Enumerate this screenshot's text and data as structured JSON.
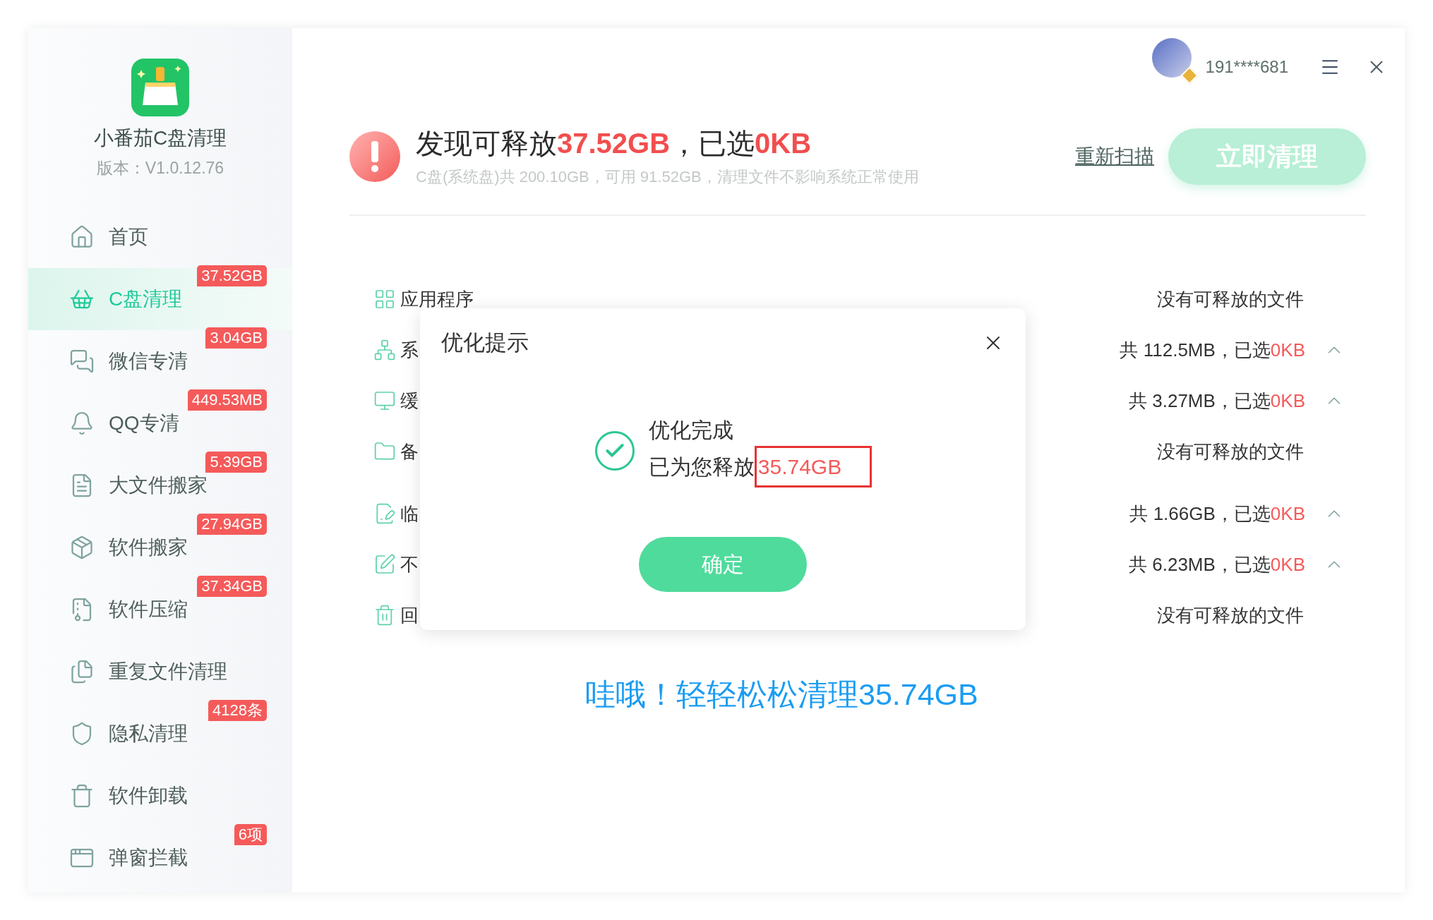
{
  "app": {
    "name": "小番茄C盘清理",
    "version": "版本：V1.0.12.76"
  },
  "nav": [
    {
      "label": "首页",
      "selected": false
    },
    {
      "label": "C盘清理",
      "badge": "37.52GB",
      "selected": true
    },
    {
      "label": "微信专清",
      "badge": "3.04GB",
      "selected": false
    },
    {
      "label": "QQ专清",
      "badge": "449.53MB",
      "selected": false
    },
    {
      "label": "大文件搬家",
      "badge": "5.39GB",
      "selected": false
    },
    {
      "label": "软件搬家",
      "badge": "27.94GB",
      "selected": false
    },
    {
      "label": "软件压缩",
      "badge": "37.34GB",
      "selected": false
    },
    {
      "label": "重复文件清理",
      "selected": false
    },
    {
      "label": "隐私清理",
      "badge": "4128条",
      "selected": false
    },
    {
      "label": "软件卸载",
      "selected": false
    },
    {
      "label": "弹窗拦截",
      "badge": "6项",
      "selected": false
    }
  ],
  "user": {
    "name": "191****681"
  },
  "header": {
    "title_prefix": "发现可释放",
    "found": "37.52GB",
    "title_mid": "，已选",
    "chosen": "0KB",
    "subtitle": "C盘(系统盘)共 200.10GB，可用 91.52GB，清理文件不影响系统正常使用",
    "rescan": "重新扫描",
    "clean_button": "立即清理"
  },
  "categories": [
    {
      "label": "应用程序",
      "kind": "empty",
      "status": "没有可释放的文件"
    },
    {
      "label": "系",
      "kind": "sized",
      "total": "共 112.5MB，已选",
      "chosen": "0KB"
    },
    {
      "label": "缓",
      "kind": "sized",
      "total": "共 3.27MB，已选",
      "chosen": "0KB"
    },
    {
      "label": "备",
      "kind": "empty",
      "status": "没有可释放的文件"
    },
    {
      "label": "临",
      "kind": "sized",
      "total": "共 1.66GB，已选",
      "chosen": "0KB"
    },
    {
      "label": "不",
      "kind": "sized",
      "total": "共 6.23MB，已选",
      "chosen": "0KB"
    },
    {
      "label": "回",
      "kind": "empty",
      "status": "没有可释放的文件"
    }
  ],
  "dialog": {
    "title": "优化提示",
    "heading": "优化完成",
    "message": "已为您释放",
    "amount": "35.74GB",
    "confirm": "确定"
  },
  "result": "哇哦！轻轻松松清理35.74GB"
}
